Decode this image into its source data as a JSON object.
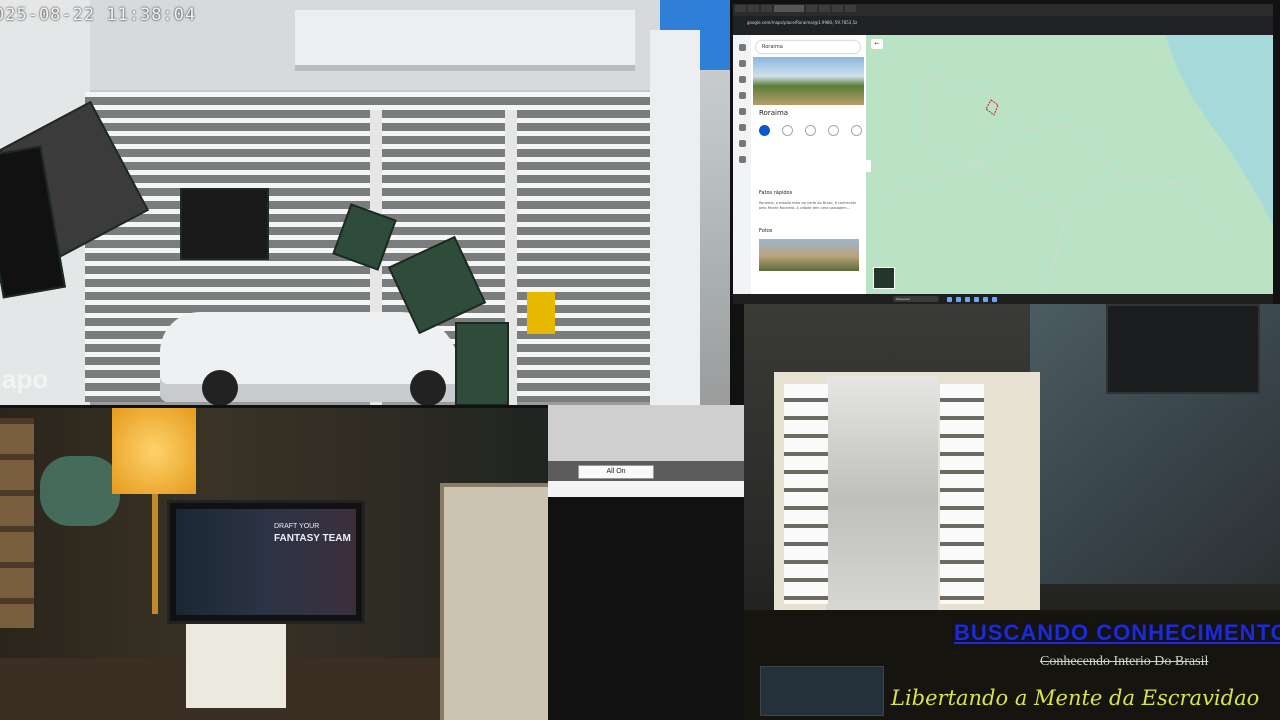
{
  "camera_front": {
    "timestamp": "025-08-22 11:38:04",
    "watermark": "apo"
  },
  "browser": {
    "url": "google.com/maps/place/Roraima/@1.9980,-59.7853,5z",
    "maps": {
      "search_value": "Roraima",
      "place_name": "Roraima",
      "quick_facts_label": "Fatos rápidos",
      "description": "Roraima, o estado mais ao norte do Brasil, é conhecido pelo Monte Roraima. A cidade tem uma paisagem...",
      "photos_label": "Fotos",
      "back_icon": "←"
    },
    "taskbar": {
      "search_placeholder": "Pesquisar"
    }
  },
  "control": {
    "all_on_label": "All On"
  },
  "desk_monitor": {
    "line1": "DRAFT YOUR",
    "line2": "FANTASY TEAM"
  },
  "overlay": {
    "title": "BUSCANDO CONHECIMENTO",
    "subtitle": "Conhecendo Interio Do Brasil",
    "tagline": "Libertando a Mente da Escravidao"
  },
  "colors": {
    "title_blue": "#1d2bd0",
    "tagline_yellow": "#d9e34a",
    "map_water": "#a6d9d9",
    "map_land": "#b9e3c4"
  }
}
